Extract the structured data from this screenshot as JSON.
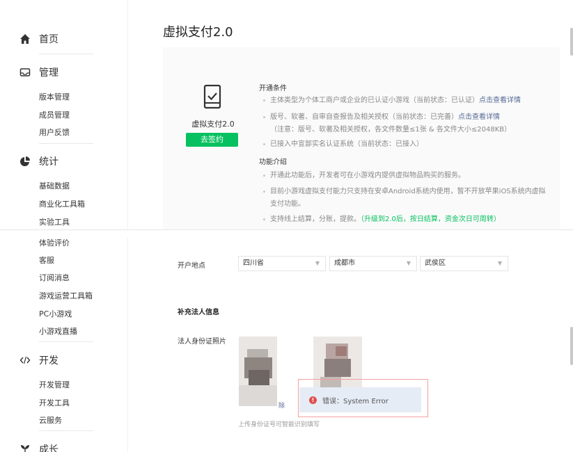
{
  "sidebar": {
    "home": "首页",
    "manage": {
      "label": "管理",
      "items": [
        "版本管理",
        "成员管理",
        "用户反馈"
      ]
    },
    "stats": {
      "label": "统计",
      "items": [
        "基础数据",
        "商业化工具箱",
        "实验工具"
      ]
    },
    "misc_items": [
      "体验评价",
      "客服",
      "订阅消息",
      "游戏运营工具箱",
      "PC小游戏",
      "小游戏直播"
    ],
    "dev": {
      "label": "开发",
      "items": [
        "开发管理",
        "开发工具",
        "云服务"
      ]
    },
    "growth": "成长"
  },
  "main": {
    "title": "虚拟支付2.0",
    "product_name": "虚拟支付2.0",
    "sign_button": "去签约",
    "conditions_title": "开通条件",
    "cond1_text": "主体类型为个体工商户或企业的已认证小游戏（当前状态：已认证）",
    "cond1_link": "点击查看详情",
    "cond2_text": "版号、软著、自审自查报告及相关授权（当前状态：已完善）",
    "cond2_link": "点击查看详情",
    "cond2_note": "（注意：版号、软著及相关授权，各文件数量≤1张 & 各文件大小≤2048KB）",
    "cond3_text": "已接入中宣部实名认证系统（当前状态：已接入）",
    "features_title": "功能介绍",
    "feat1": "开通此功能后，开发者可在小游戏内提供虚拟物品购买的服务。",
    "feat2_line1": "目前小游戏虚拟支付能力只支持在安卓Android系统内使用，暂不开放苹果iOS系统内虚拟",
    "feat2_line2": "支付功能。",
    "feat3_text": "支持线上结算，分账，提款。",
    "feat3_highlight": "（升级到2.0后，按日结算，资金次日可周转）"
  },
  "form": {
    "location_label": "开户地点",
    "province": "四川省",
    "city": "成都市",
    "district": "武侯区",
    "legal_section": "补充法人信息",
    "id_photo_label": "法人身份证照片",
    "delete_fragment": "除",
    "error_text": "错误：System Error",
    "hint": "上传身份证号可智能识别填写"
  },
  "colors": {
    "brand_green": "#07c160",
    "link_blue": "#576b95",
    "error_red": "#e0504f"
  }
}
